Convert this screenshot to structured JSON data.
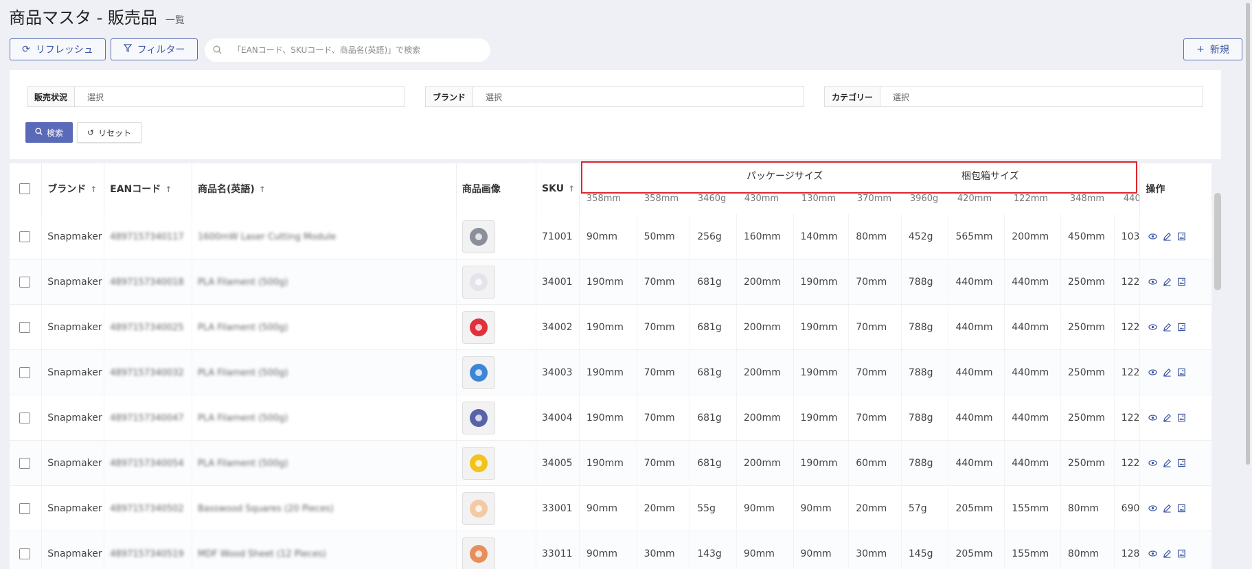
{
  "page": {
    "title": "商品マスタ - 販売品",
    "subtitle": "一覧"
  },
  "toolbar": {
    "refresh_label": "リフレッシュ",
    "filter_label": "フィルター",
    "search_placeholder": "「EANコード、SKUコード、商品名(英語)」で検索",
    "new_label": "新規"
  },
  "filters": {
    "status_label": "販売状況",
    "status_value": "選択",
    "brand_label": "ブランド",
    "brand_value": "選択",
    "category_label": "カテゴリー",
    "category_value": "選択",
    "search_button": "検索",
    "reset_button": "リセット"
  },
  "table": {
    "headers": {
      "brand": "ブランド",
      "ean": "EANコード",
      "name": "商品名(英語)",
      "image": "商品画像",
      "sku": "SKU",
      "package_size": "パッケージサイズ",
      "box_size": "梱包箱サイズ",
      "actions": "操作"
    },
    "partial_row": [
      "358mm",
      "358mm",
      "3460g",
      "430mm",
      "130mm",
      "370mm",
      "3960g",
      "420mm",
      "122mm",
      "348mm",
      "440"
    ],
    "rows": [
      {
        "brand": "Snapmaker",
        "ean": "4897157340117",
        "name": "1600mW Laser Cutting Module",
        "sku": "71001",
        "image_color": "#8a8f99",
        "dims": [
          "90mm",
          "50mm",
          "256g",
          "160mm",
          "140mm",
          "80mm",
          "452g",
          "565mm",
          "200mm",
          "450mm",
          "103"
        ]
      },
      {
        "brand": "Snapmaker",
        "ean": "4897157340018",
        "name": "PLA Filament (500g)",
        "sku": "34001",
        "image_color": "#e5e3ec",
        "dims": [
          "190mm",
          "70mm",
          "681g",
          "200mm",
          "190mm",
          "70mm",
          "788g",
          "440mm",
          "440mm",
          "250mm",
          "122"
        ]
      },
      {
        "brand": "Snapmaker",
        "ean": "4897157340025",
        "name": "PLA Filament (500g)",
        "sku": "34002",
        "image_color": "#e0303a",
        "dims": [
          "190mm",
          "70mm",
          "681g",
          "200mm",
          "190mm",
          "70mm",
          "788g",
          "440mm",
          "440mm",
          "250mm",
          "122"
        ]
      },
      {
        "brand": "Snapmaker",
        "ean": "4897157340032",
        "name": "PLA Filament (500g)",
        "sku": "34003",
        "image_color": "#3d86d6",
        "dims": [
          "190mm",
          "70mm",
          "681g",
          "200mm",
          "190mm",
          "70mm",
          "788g",
          "440mm",
          "440mm",
          "250mm",
          "122"
        ]
      },
      {
        "brand": "Snapmaker",
        "ean": "4897157340047",
        "name": "PLA Filament (500g)",
        "sku": "34004",
        "image_color": "#5862a8",
        "dims": [
          "190mm",
          "70mm",
          "681g",
          "200mm",
          "190mm",
          "70mm",
          "788g",
          "440mm",
          "440mm",
          "250mm",
          "122"
        ]
      },
      {
        "brand": "Snapmaker",
        "ean": "4897157340054",
        "name": "PLA Filament (500g)",
        "sku": "34005",
        "image_color": "#f3c21b",
        "dims": [
          "190mm",
          "70mm",
          "681g",
          "200mm",
          "190mm",
          "60mm",
          "788g",
          "440mm",
          "440mm",
          "250mm",
          "122"
        ]
      },
      {
        "brand": "Snapmaker",
        "ean": "4897157340502",
        "name": "Basswood Squares (20 Pieces)",
        "sku": "33001",
        "image_color": "#f3caa5",
        "dims": [
          "90mm",
          "20mm",
          "55g",
          "90mm",
          "90mm",
          "20mm",
          "57g",
          "205mm",
          "155mm",
          "80mm",
          "690"
        ]
      },
      {
        "brand": "Snapmaker",
        "ean": "4897157340519",
        "name": "MDF Wood Sheet (12 Pieces)",
        "sku": "33011",
        "image_color": "#e78f5c",
        "dims": [
          "90mm",
          "30mm",
          "143g",
          "90mm",
          "90mm",
          "30mm",
          "145g",
          "205mm",
          "155mm",
          "80mm",
          "128"
        ]
      }
    ]
  },
  "colors": {
    "accent": "#5b6ab8",
    "highlight_border": "#e0242c"
  }
}
